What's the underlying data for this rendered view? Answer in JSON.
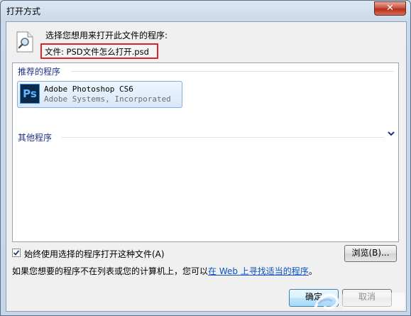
{
  "window": {
    "title": "打开方式",
    "close_label": "✕"
  },
  "prompt": "选择您想用来打开此文件的程序:",
  "file": {
    "label": "文件: PSD文件怎么打开.psd"
  },
  "groups": {
    "recommended": "推荐的程序",
    "other": "其他程序"
  },
  "apps": [
    {
      "icon_text": "Ps",
      "name": "Adobe Photoshop CS6",
      "publisher": "Adobe Systems, Incorporated"
    }
  ],
  "checkbox": {
    "label": "始终使用选择的程序打开这种文件(A)",
    "checked": true
  },
  "browse_label": "浏览(B)...",
  "hint": {
    "before": "如果您想要的程序不在列表或您的计算机上，您可以",
    "link": "在 Web 上寻找适当的程序",
    "after": "。"
  },
  "buttons": {
    "ok": "确定",
    "cancel": "取消"
  },
  "colors": {
    "highlight_border": "#e0232a",
    "group_header": "#1e3287",
    "link": "#0b53c4",
    "selection": "#84acdd"
  },
  "icons": [
    "file-search-icon",
    "photoshop-icon",
    "expand-chevron-icon",
    "close-icon"
  ]
}
